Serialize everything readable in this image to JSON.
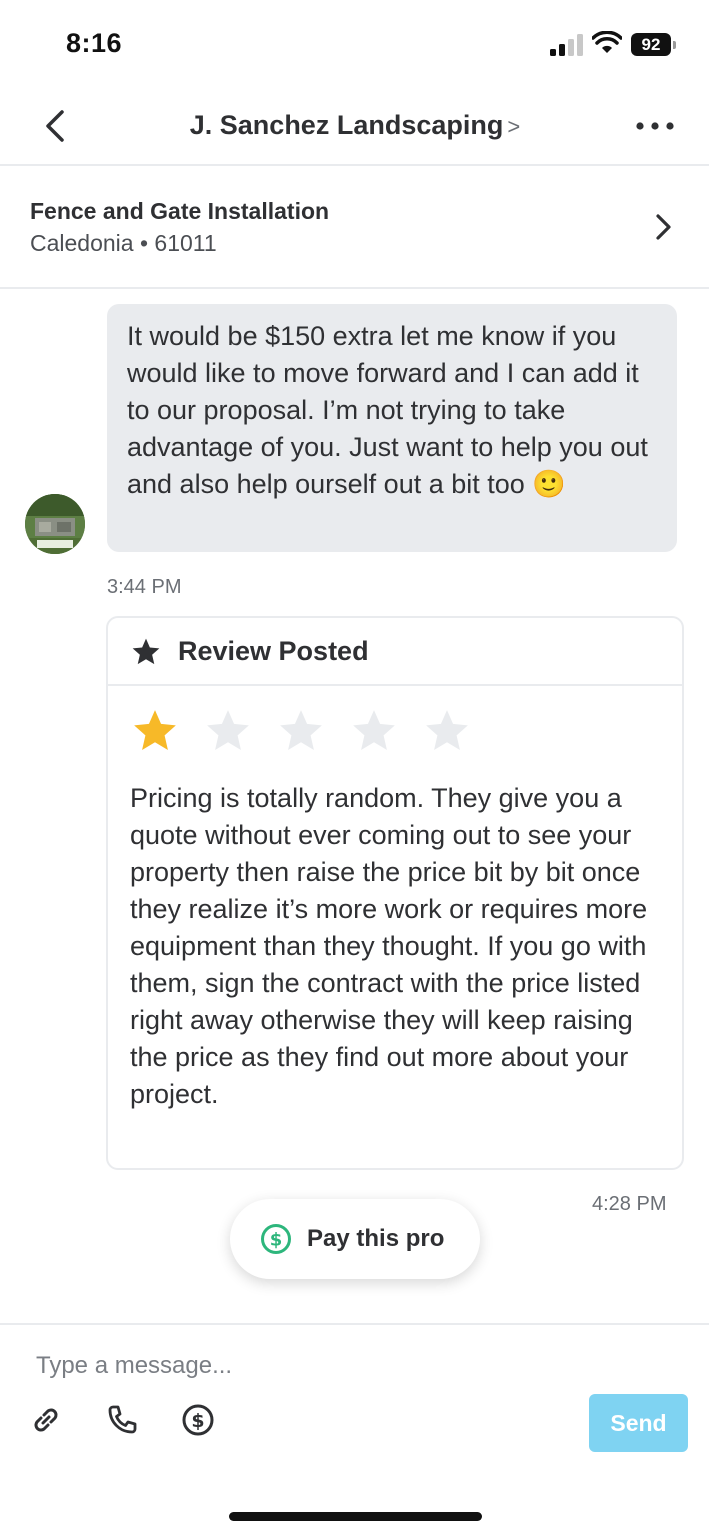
{
  "status_bar": {
    "time": "8:16",
    "battery": "92"
  },
  "header": {
    "title": "J. Sanchez Landscaping",
    "chevron": ">"
  },
  "project": {
    "title": "Fence and Gate Installation",
    "location": "Caledonia • 61011"
  },
  "messages": [
    {
      "text": "It would be $150 extra let me know if you would like to move forward and I can add it to our proposal. I’m not trying to take advantage of you. Just want to help you out and also help ourself out a bit too 🙂",
      "time": "3:44 PM"
    }
  ],
  "review": {
    "heading": "Review Posted",
    "rating": 1,
    "max_rating": 5,
    "text": "Pricing is totally random. They give you a quote without ever coming out to see your property then raise the price bit by bit once they realize it’s more work or requires more equipment than they thought. If you go with them, sign the contract with the price listed right away otherwise they will keep raising the price as they find out more about your project.",
    "time": "4:28 PM"
  },
  "pay_button": {
    "label": "Pay this pro",
    "icon": "dollar-circle-icon"
  },
  "composer": {
    "placeholder": "Type a message...",
    "send_label": "Send",
    "tools": [
      "paperclip-icon",
      "phone-icon",
      "dollar-circle-icon"
    ]
  },
  "colors": {
    "star_filled": "#F7B928",
    "star_empty": "#E9EBEE",
    "bubble_bg": "#E9EBEE",
    "send_button": "#7FD3F2",
    "pay_icon": "#2DB67C"
  }
}
